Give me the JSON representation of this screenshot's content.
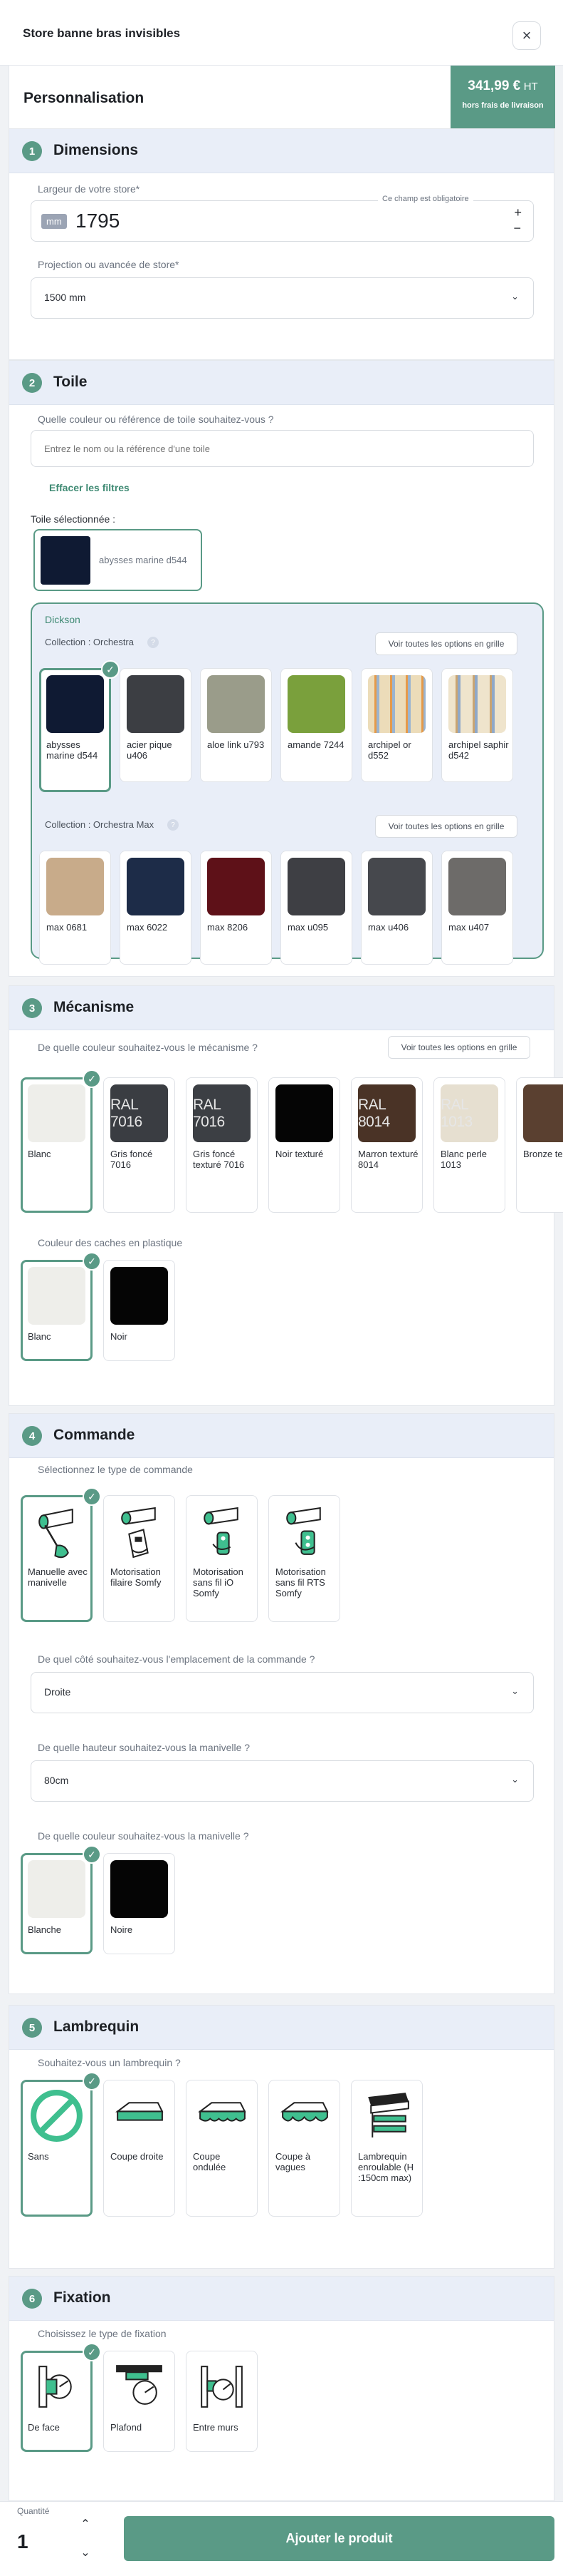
{
  "header": {
    "title": "Store banne bras invisibles",
    "close": "×"
  },
  "perso": {
    "title": "Personnalisation",
    "price": "341,99 €",
    "price_unit": "HT",
    "price_note": "hors frais de livraison"
  },
  "dimensions": {
    "num": "1",
    "title": "Dimensions",
    "width_label": "Largeur de votre store*",
    "required_note": "Ce champ est obligatoire",
    "unit": "mm",
    "width_value": "1795",
    "plus": "+",
    "minus": "−",
    "projection_label": "Projection ou avancée de store*",
    "projection_value": "1500 mm"
  },
  "toile": {
    "num": "2",
    "title": "Toile",
    "question": "Quelle couleur ou référence de toile souhaitez-vous ?",
    "search_placeholder": "Entrez le nom ou la référence d'une toile",
    "clear_filters": "Effacer les filtres",
    "selected_label": "Toile sélectionnée :",
    "selected_name": "abysses marine d544",
    "brand": "Dickson",
    "collections": [
      {
        "name": "Collection : Orchestra",
        "grid_button": "Voir toutes les options en grille",
        "items": [
          {
            "label": "abysses marine d544",
            "color": "#0f1a33",
            "selected": true
          },
          {
            "label": "acier pique u406",
            "color": "#3c3e43"
          },
          {
            "label": "aloe link u793",
            "color": "#9a9c8a"
          },
          {
            "label": "amande 7244",
            "color": "#7aa03c"
          },
          {
            "label": "archipel or d552",
            "color": "#e9d9b8"
          },
          {
            "label": "archipel saphir d542",
            "color": "#efe4cc"
          }
        ]
      },
      {
        "name": "Collection : Orchestra Max",
        "grid_button": "Voir toutes les options en grille",
        "items": [
          {
            "label": "max 0681",
            "color": "#c8ab8a"
          },
          {
            "label": "max 6022",
            "color": "#1d2c48"
          },
          {
            "label": "max 8206",
            "color": "#5e1118"
          },
          {
            "label": "max u095",
            "color": "#3e3f44"
          },
          {
            "label": "max u406",
            "color": "#46484d"
          },
          {
            "label": "max u407",
            "color": "#6d6b69"
          }
        ]
      }
    ]
  },
  "mecanisme": {
    "num": "3",
    "title": "Mécanisme",
    "question": "De quelle couleur souhaitez-vous le mécanisme ?",
    "grid_button": "Voir toutes les options en grille",
    "items": [
      {
        "label": "Blanc",
        "color": "#eeeeea",
        "text": "",
        "selected": true
      },
      {
        "label": "Gris foncé 7016",
        "color": "#3a3d42",
        "text": "RAL 7016"
      },
      {
        "label": "Gris foncé texturé 7016",
        "color": "#3c3f44",
        "text": "RAL 7016"
      },
      {
        "label": "Noir texturé",
        "color": "#050505",
        "text": ""
      },
      {
        "label": "Marron texturé 8014",
        "color": "#4a3326",
        "text": "RAL 8014"
      },
      {
        "label": "Blanc perle 1013",
        "color": "#e6dfd0",
        "text": "RAL 1013"
      },
      {
        "label": "Bronze texturé",
        "color": "#5a4030",
        "text": ""
      }
    ],
    "caches_question": "Couleur des caches en plastique",
    "caches": [
      {
        "label": "Blanc",
        "color": "#eeeeea",
        "selected": true
      },
      {
        "label": "Noir",
        "color": "#050505"
      }
    ]
  },
  "commande": {
    "num": "4",
    "title": "Commande",
    "question": "Sélectionnez le type de commande",
    "items": [
      {
        "label": "Manuelle avec manivelle",
        "icon": "crank-icon",
        "selected": true
      },
      {
        "label": "Motorisation filaire Somfy",
        "icon": "wired-remote-icon"
      },
      {
        "label": "Motorisation sans fil iO Somfy",
        "icon": "remote-io-icon"
      },
      {
        "label": "Motorisation sans fil RTS Somfy",
        "icon": "remote-rts-icon"
      }
    ],
    "side_question": "De quel côté souhaitez-vous l'emplacement de la commande ?",
    "side_value": "Droite",
    "height_question": "De quelle hauteur souhaitez-vous la manivelle ?",
    "height_value": "80cm",
    "color_question": "De quelle couleur souhaitez-vous la manivelle ?",
    "colors": [
      {
        "label": "Blanche",
        "color": "#eeeeea",
        "selected": true
      },
      {
        "label": "Noire",
        "color": "#050505"
      }
    ]
  },
  "lambrequin": {
    "num": "5",
    "title": "Lambrequin",
    "question": "Souhaitez-vous un lambrequin ?",
    "items": [
      {
        "label": "Sans",
        "icon": "no-icon",
        "selected": true
      },
      {
        "label": "Coupe droite",
        "icon": "straight-cut-icon"
      },
      {
        "label": "Coupe ondulée",
        "icon": "wavy-cut-icon"
      },
      {
        "label": "Coupe à vagues",
        "icon": "waves-cut-icon"
      },
      {
        "label": "Lambrequin enroulable (H :150cm max)",
        "icon": "roller-valance-icon"
      }
    ]
  },
  "fixation": {
    "num": "6",
    "title": "Fixation",
    "question": "Choisissez le type de fixation",
    "items": [
      {
        "label": "De face",
        "icon": "wall-front-icon",
        "selected": true
      },
      {
        "label": "Plafond",
        "icon": "ceiling-icon"
      },
      {
        "label": "Entre murs",
        "icon": "between-walls-icon"
      }
    ]
  },
  "footer": {
    "qty_label": "Quantité",
    "qty_value": "1",
    "up": "⌃",
    "down": "⌄",
    "add_button": "Ajouter le produit"
  },
  "colors": {
    "accent": "#5a9a86",
    "section_header": "#e9eef8"
  }
}
